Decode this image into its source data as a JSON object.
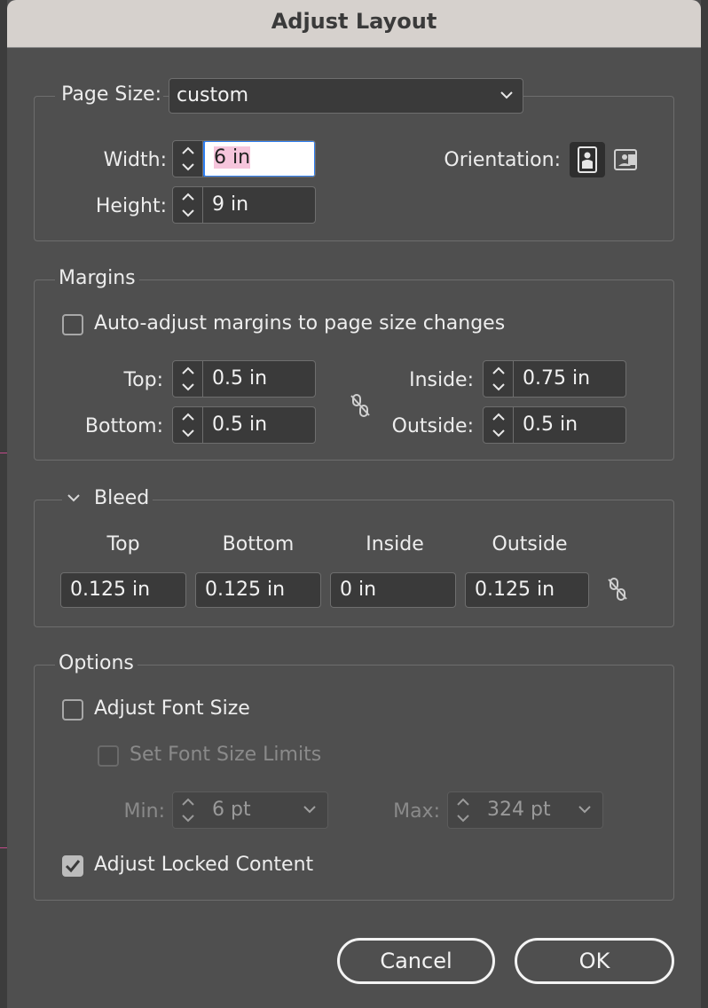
{
  "window": {
    "title": "Adjust Layout"
  },
  "page_size": {
    "label": "Page Size:",
    "value": "custom",
    "width_label": "Width:",
    "width_value": "6 in",
    "height_label": "Height:",
    "height_value": "9 in",
    "orientation_label": "Orientation:",
    "orientation_selected": "portrait"
  },
  "margins": {
    "section_label": "Margins",
    "auto_adjust_label": "Auto-adjust margins to page size changes",
    "auto_adjust_checked": false,
    "top_label": "Top:",
    "top_value": "0.5 in",
    "bottom_label": "Bottom:",
    "bottom_value": "0.5 in",
    "inside_label": "Inside:",
    "inside_value": "0.75 in",
    "outside_label": "Outside:",
    "outside_value": "0.5 in"
  },
  "bleed": {
    "section_label": "Bleed",
    "headers": [
      "Top",
      "Bottom",
      "Inside",
      "Outside"
    ],
    "values": [
      "0.125 in",
      "0.125 in",
      "0 in",
      "0.125 in"
    ]
  },
  "options": {
    "section_label": "Options",
    "adjust_font_size_label": "Adjust Font Size",
    "adjust_font_size_checked": false,
    "set_font_size_limits_label": "Set Font Size Limits",
    "set_font_size_limits_checked": false,
    "min_label": "Min:",
    "min_value": "6 pt",
    "max_label": "Max:",
    "max_value": "324 pt",
    "adjust_locked_content_label": "Adjust Locked Content",
    "adjust_locked_content_checked": true
  },
  "buttons": {
    "cancel": "Cancel",
    "ok": "OK"
  },
  "colors": {
    "background": "#4f4f4f",
    "titlebar": "#d6d1cd",
    "focus_ring": "#2f7ff2",
    "selection": "#f6c5dc"
  }
}
